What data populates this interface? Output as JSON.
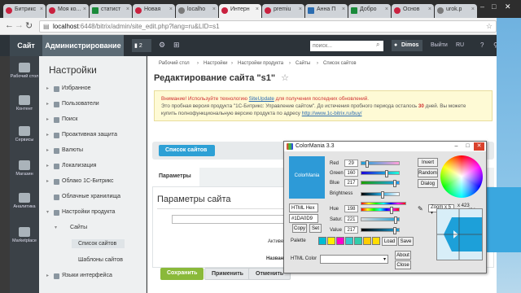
{
  "browser": {
    "tabs": [
      {
        "label": "Битрикс",
        "icon": "bitrix-icon"
      },
      {
        "label": "Моя ко...",
        "icon": "bitrix-icon"
      },
      {
        "label": "статист",
        "icon": "chart-icon"
      },
      {
        "label": "Новая",
        "icon": "bitrix-icon"
      },
      {
        "label": "localho",
        "icon": "page-icon"
      },
      {
        "label": "Интерн",
        "icon": "bitrix-icon"
      },
      {
        "label": "premiu",
        "icon": "bitrix-icon"
      },
      {
        "label": "Анна П",
        "icon": "vk-icon"
      },
      {
        "label": "Добро",
        "icon": "doc-icon"
      },
      {
        "label": "Основ",
        "icon": "bitrix-icon"
      },
      {
        "label": "urok.p",
        "icon": "page-icon"
      }
    ],
    "url_host": "localhost",
    "url_rest": ":6448/bitrix/admin/site_edit.php?lang=ru&LID=s1"
  },
  "top_panel": {
    "site_label": "Сайт",
    "admin_label": "Администрирование",
    "notif_count": "2",
    "search_placeholder": "поиск...",
    "user_name": "Dimos",
    "logout_label": "Выйти",
    "lang_label": "RU"
  },
  "left_menu": [
    {
      "label": "Рабочий стол",
      "icon": "desktop-icon"
    },
    {
      "label": "Контент",
      "icon": "content-icon"
    },
    {
      "label": "Сервисы",
      "icon": "services-icon"
    },
    {
      "label": "Магазин",
      "icon": "cart-icon"
    },
    {
      "label": "Аналитика",
      "icon": "analytics-icon"
    },
    {
      "label": "Marketplace",
      "icon": "marketplace-icon"
    }
  ],
  "settings_menu": {
    "title": "Настройки",
    "items": [
      {
        "label": "Избранное"
      },
      {
        "label": "Пользователи"
      },
      {
        "label": "Поиск"
      },
      {
        "label": "Проактивная защита"
      },
      {
        "label": "Валюты"
      },
      {
        "label": "Локализация"
      },
      {
        "label": "Облако 1С-Битрикс"
      },
      {
        "label": "Облачные хранилища"
      },
      {
        "label": "Настройки продукта"
      },
      {
        "label": "Сайты"
      },
      {
        "label": "Список сайтов"
      },
      {
        "label": "Шаблоны сайтов"
      },
      {
        "label": "Языки интерфейса"
      }
    ]
  },
  "content": {
    "breadcrumbs": [
      "Рабочий стол",
      "Настройки",
      "Настройки продукта",
      "Сайты",
      "Список сайтов"
    ],
    "title": "Редактирование сайта \"s1\"",
    "warning_line1_red": "Внимание! Используйте технологию ",
    "warning_link1": "SiteUpdate",
    "warning_line1_rest": " для получения последних обновлений.",
    "warning_line2": "Это пробная версия продукта \"1С-Битрикс: Управление сайтом\". До истечения пробного периода осталось ",
    "warning_days": "30",
    "warning_line2_rest": " дней. Вы можете",
    "warning_line3": "купить полнофункциональную версию продукта по адресу ",
    "warning_link2": "http://www.1c-bitrix.ru/buy/",
    "sites_tab": "Список сайтов",
    "params_tab": "Параметры",
    "params_title": "Параметры сайта",
    "field_active": "Активе",
    "field_name": "Названи",
    "save": "Сохранить",
    "apply": "Применить",
    "cancel": "Отменить"
  },
  "colormania": {
    "title": "ColorMania 3.3",
    "preview_label": "ColorMania",
    "red_label": "Red",
    "red": "29",
    "green_label": "Green",
    "green": "160",
    "blue_label": "Blue",
    "blue": "217",
    "brightness_label": "Brightness",
    "hue_label": "Hue",
    "hue": "198",
    "sat_label": "Satur.",
    "sat": "221",
    "value_label": "Value",
    "value": "217",
    "format": "HTML Hex",
    "hex_value": "#1DA0D9",
    "copy": "Copy",
    "set": "Set",
    "invert": "Invert",
    "random": "Random",
    "dialog": "Dialog",
    "zoom": "Zoom x 5",
    "coord_x": "423",
    "coord_y": "434",
    "palette_label": "Palette",
    "palette": [
      "#00bcd4",
      "#ffee00",
      "#ff00cc",
      "#33cccc",
      "#33ccaa",
      "#ffcc00",
      "#ffdd00"
    ],
    "load": "Load",
    "save": "Save",
    "html_color_label": "HTML Color",
    "about": "About",
    "close": "Close",
    "color": "#1DA0D9"
  }
}
